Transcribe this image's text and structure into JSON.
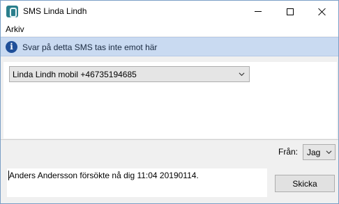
{
  "window": {
    "title": "SMS Linda Lindh"
  },
  "menu": {
    "items": [
      {
        "label": "Arkiv"
      }
    ]
  },
  "info_bar": {
    "message": "Svar på detta SMS tas inte emot här"
  },
  "recipient": {
    "selected": "Linda Lindh mobil +46735194685"
  },
  "sender": {
    "label": "Från:",
    "selected": "Jag"
  },
  "message": {
    "value": "Anders Andersson försökte nå dig 11:04 20190114."
  },
  "send_button": {
    "label": "Skicka"
  }
}
